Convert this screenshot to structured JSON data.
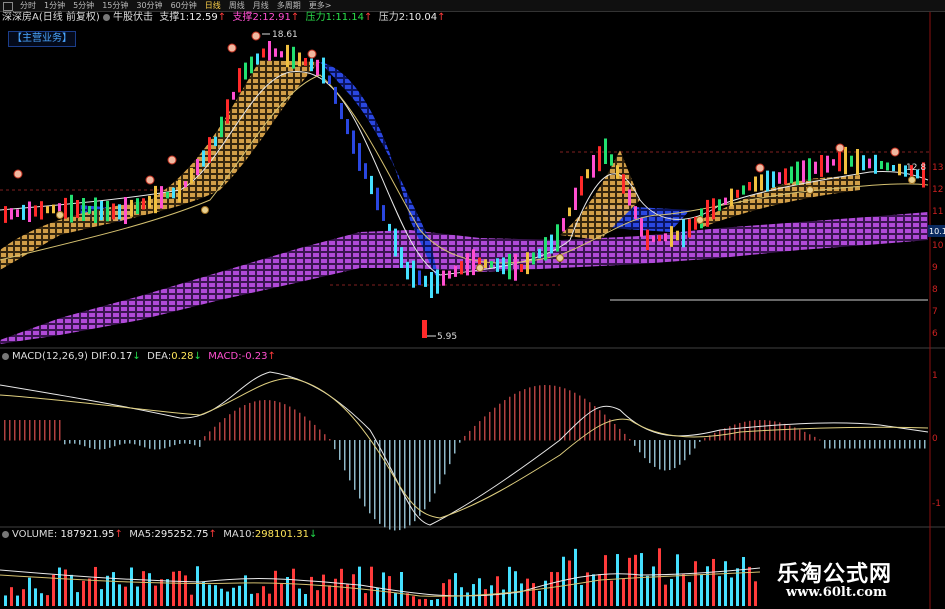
{
  "toolbar": {
    "tabs": [
      "分时",
      "1分钟",
      "5分钟",
      "15分钟",
      "30分钟",
      "60分钟",
      "日线",
      "周线",
      "月线",
      "多周期",
      "更多>"
    ],
    "active_tab": "日线"
  },
  "header": {
    "stock": "深深房A",
    "mode": "(日线 前复权)",
    "indicator": "牛股伏击",
    "support1_label": "支撑1:",
    "support1_value": "12.59",
    "support2_label": "支撑2:",
    "support2_value": "12.91",
    "pressure1_label": "压力1:",
    "pressure1_value": "11.14",
    "pressure2_label": "压力2:",
    "pressure2_value": "10.04"
  },
  "badge": "【主营业务】",
  "price_panel": {
    "high_label": "18.61",
    "low_label": "5.95",
    "last_label": "12.8",
    "right_tag": "10.1",
    "y_ticks": [
      "13",
      "12",
      "11",
      "10",
      "9",
      "8",
      "7",
      "6"
    ]
  },
  "macd": {
    "title": "MACD(12,26,9)",
    "dif_label": "DIF:",
    "dif_value": "0.17",
    "dea_label": "DEA:",
    "dea_value": "0.28",
    "macd_label": "MACD:",
    "macd_value": "-0.23",
    "y_ticks": [
      "1",
      "0",
      "-1"
    ]
  },
  "volume": {
    "title": "VOLUME:",
    "value": "187921.95",
    "ma5_label": "MA5:",
    "ma5_value": "295252.75",
    "ma10_label": "MA10:",
    "ma10_value": "298101.31"
  },
  "arrows": {
    "up": "↑",
    "down": "↓"
  },
  "watermark": {
    "brand": "乐淘公式网",
    "url": "www.60lt.com"
  },
  "colors": {
    "up": "#ff2a2a",
    "down": "#22e070",
    "ribbon": "#b04ad8",
    "blue": "#2a47e0",
    "ma": "#e8e8e8",
    "dea": "#e8d890",
    "axis": "#cc2222"
  }
}
